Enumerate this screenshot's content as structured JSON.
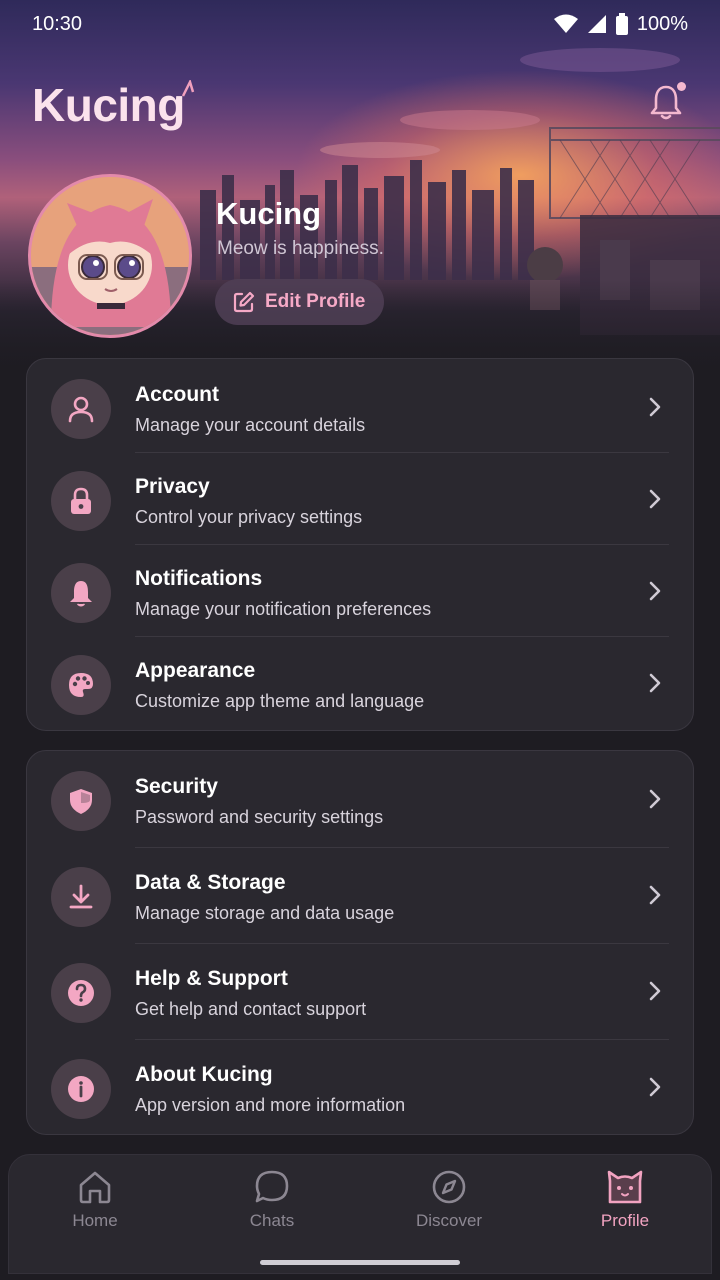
{
  "status_bar": {
    "time": "10:30",
    "battery": "100%"
  },
  "app": {
    "logo": "Kucing"
  },
  "profile": {
    "name": "Kucing",
    "bio": "Meow is happiness.",
    "edit_label": "Edit Profile"
  },
  "settings_group_1": [
    {
      "icon": "person-icon",
      "title": "Account",
      "subtitle": "Manage your account details"
    },
    {
      "icon": "lock-icon",
      "title": "Privacy",
      "subtitle": "Control your privacy settings"
    },
    {
      "icon": "bell-icon",
      "title": "Notifications",
      "subtitle": "Manage your notification preferences"
    },
    {
      "icon": "palette-icon",
      "title": "Appearance",
      "subtitle": "Customize app theme and language"
    }
  ],
  "settings_group_2": [
    {
      "icon": "shield-icon",
      "title": "Security",
      "subtitle": "Password and security settings"
    },
    {
      "icon": "download-icon",
      "title": "Data & Storage",
      "subtitle": "Manage storage and data usage"
    },
    {
      "icon": "question-icon",
      "title": "Help & Support",
      "subtitle": "Get help and contact support"
    },
    {
      "icon": "info-icon",
      "title": "About Kucing",
      "subtitle": "App version and more information"
    }
  ],
  "nav": [
    {
      "icon": "home-icon",
      "label": "Home"
    },
    {
      "icon": "chat-icon",
      "label": "Chats"
    },
    {
      "icon": "compass-icon",
      "label": "Discover"
    },
    {
      "icon": "cat-icon",
      "label": "Profile",
      "active": true
    }
  ],
  "colors": {
    "accent": "#f2a3c1",
    "card": "#2a282f",
    "background": "#1e1c22"
  }
}
